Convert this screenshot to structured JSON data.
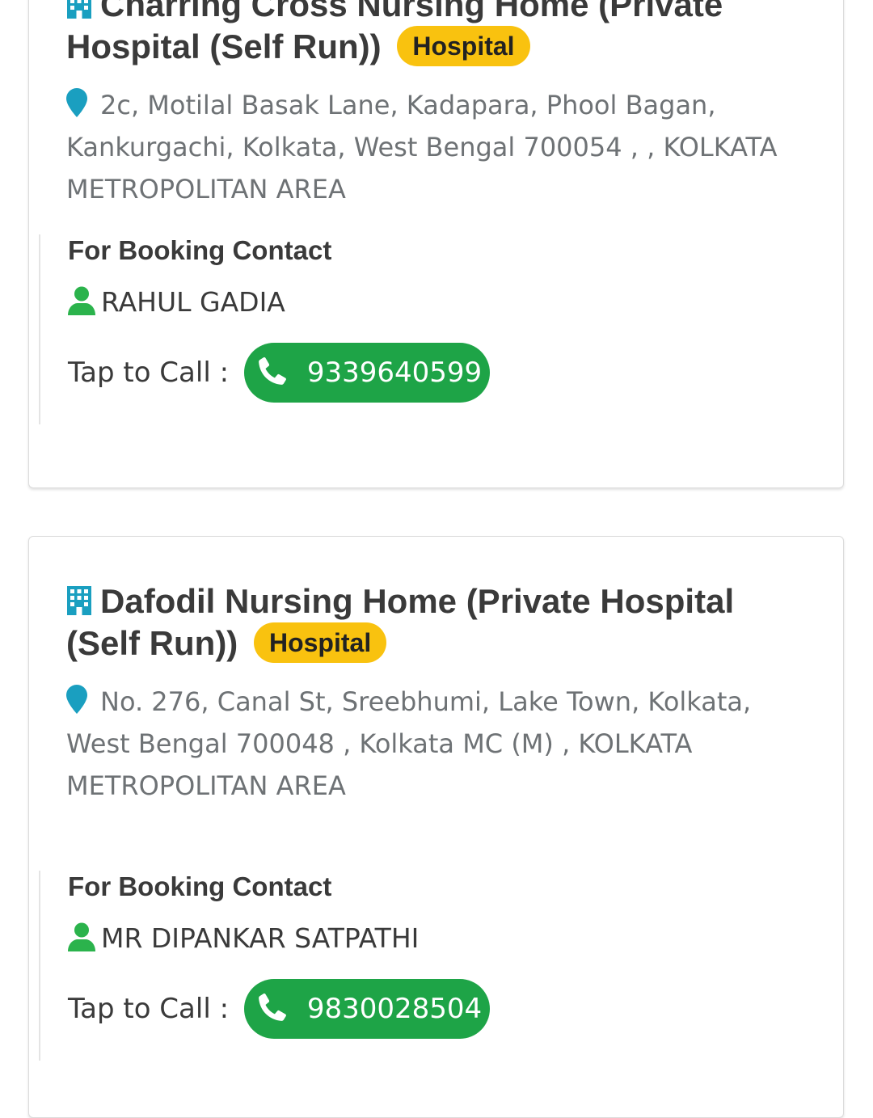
{
  "colors": {
    "badge_bg": "#f9c20f",
    "call_button_bg": "#1ea447",
    "building_icon": "#1a9fc0",
    "pin_icon": "#1a9fc0",
    "person_icon": "#2bb34c"
  },
  "listings": [
    {
      "name": "Charring Cross Nursing Home (Private Hospital (Self Run))",
      "type_badge": "Hospital",
      "icon": "building-icon",
      "address": "2c, Motilal Basak Lane, Kadapara, Phool Bagan, Kankurgachi, Kolkata, West Bengal 700054 , , KOLKATA METROPOLITAN AREA",
      "address_icon": "map-pin-icon",
      "contact_heading": "For Booking Contact",
      "contact_name": "RAHUL GADIA",
      "contact_icon": "person-icon",
      "call_label": "Tap to Call :",
      "phone": "9339640599",
      "phone_icon": "phone-icon"
    },
    {
      "name": "Dafodil Nursing Home (Private Hospital (Self Run))",
      "type_badge": "Hospital",
      "icon": "building-icon",
      "address": "No. 276, Canal St, Sreebhumi, Lake Town, Kolkata, West Bengal 700048 , Kolkata MC (M) , KOLKATA METROPOLITAN AREA",
      "address_icon": "map-pin-icon",
      "contact_heading": "For Booking Contact",
      "contact_name": "MR DIPANKAR SATPATHI",
      "contact_icon": "person-icon",
      "call_label": "Tap to Call :",
      "phone": "9830028504",
      "phone_icon": "phone-icon"
    }
  ]
}
